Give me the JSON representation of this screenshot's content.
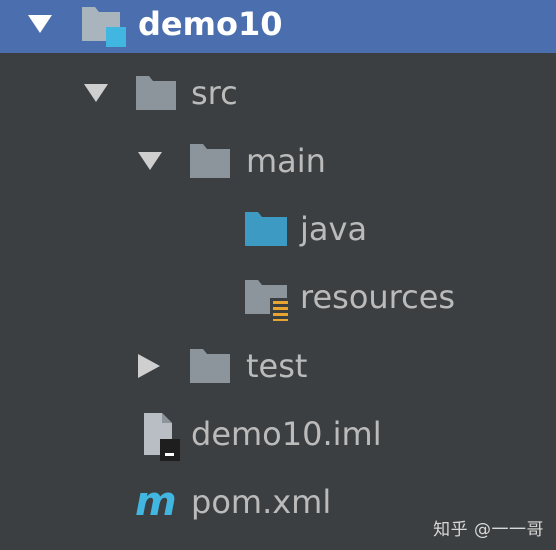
{
  "project_tree": {
    "root": {
      "label": "demo10",
      "expanded": true,
      "selected": true,
      "icon": "module-folder-icon"
    },
    "items": [
      {
        "label": "src",
        "expanded": true,
        "icon": "folder-icon"
      },
      {
        "label": "main",
        "expanded": true,
        "icon": "folder-icon"
      },
      {
        "label": "java",
        "icon": "source-root-folder-icon"
      },
      {
        "label": "resources",
        "icon": "resources-root-folder-icon"
      },
      {
        "label": "test",
        "expanded": false,
        "icon": "folder-icon"
      },
      {
        "label": "demo10.iml",
        "icon": "iml-file-icon"
      },
      {
        "label": "pom.xml",
        "icon": "maven-file-icon"
      }
    ]
  },
  "watermark": "知乎 @一一哥",
  "colors": {
    "background": "#3c3f41",
    "selection": "#4b6eaf",
    "text": "#bbbbbb",
    "folder": "#8c959c",
    "source_folder": "#3d9ac2",
    "accent_blue": "#40b6e0",
    "resources_badge": "#e8a530"
  }
}
